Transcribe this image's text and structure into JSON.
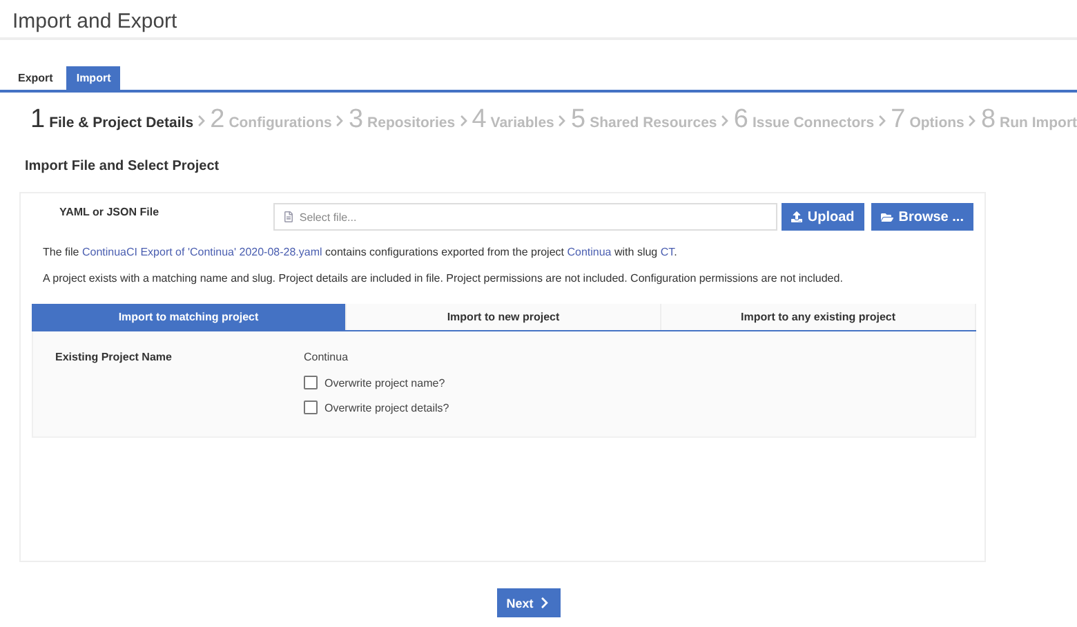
{
  "page_title": "Import and Export",
  "tabs": [
    {
      "label": "Export",
      "selected": false
    },
    {
      "label": "Import",
      "selected": true
    }
  ],
  "steps": [
    {
      "number": "1",
      "label": "File & Project Details",
      "selected": true
    },
    {
      "number": "2",
      "label": "Configurations",
      "selected": false
    },
    {
      "number": "3",
      "label": "Repositories",
      "selected": false
    },
    {
      "number": "4",
      "label": "Variables",
      "selected": false
    },
    {
      "number": "5",
      "label": "Shared Resources",
      "selected": false
    },
    {
      "number": "6",
      "label": "Issue Connectors",
      "selected": false
    },
    {
      "number": "7",
      "label": "Options",
      "selected": false
    },
    {
      "number": "8",
      "label": "Run Import",
      "selected": false
    }
  ],
  "section_heading": "Import File and Select Project",
  "file_field": {
    "label": "YAML or JSON File",
    "placeholder": "Select file...",
    "upload_button": "Upload",
    "browse_button": "Browse ..."
  },
  "file_info": [
    {
      "kind": "plain",
      "text": "The file "
    },
    {
      "kind": "link",
      "text": "ContinuaCI Export of 'Continua' 2020-08-28.yaml"
    },
    {
      "kind": "plain",
      "text": " contains configurations exported from the project "
    },
    {
      "kind": "link",
      "text": "Continua"
    },
    {
      "kind": "plain",
      "text": " with slug "
    },
    {
      "kind": "link",
      "text": "CT"
    },
    {
      "kind": "plain",
      "text": "."
    }
  ],
  "project_info": "A project exists with a matching name and slug. Project details are included in file. Project permissions are not included. Configuration permissions are not included.",
  "mode_tabs": [
    {
      "label": "Import to matching project",
      "selected": true
    },
    {
      "label": "Import to new project",
      "selected": false
    },
    {
      "label": "Import to any existing project",
      "selected": false
    }
  ],
  "existing_project": {
    "label": "Existing Project Name",
    "value": "Continua"
  },
  "options": [
    {
      "label": "Overwrite project name?",
      "checked": false
    },
    {
      "label": "Overwrite project details?",
      "checked": false
    }
  ],
  "next_button": "Next"
}
